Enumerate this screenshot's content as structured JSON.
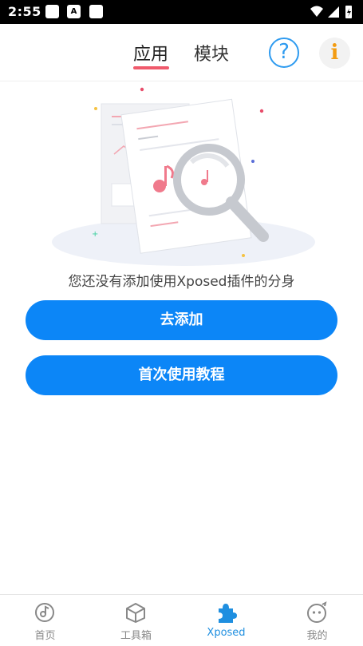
{
  "status_bar": {
    "time": "2:55"
  },
  "header": {
    "tabs": [
      {
        "label": "应用",
        "active": true
      },
      {
        "label": "模块",
        "active": false
      }
    ],
    "help_icon": "question-circle-icon",
    "info_icon": "info-icon",
    "help_glyph": "?",
    "info_glyph": "i"
  },
  "empty_state": {
    "illustration": "document-magnifier-illustration",
    "message": "您还没有添加使用Xposed插件的分身"
  },
  "actions": {
    "add_label": "去添加",
    "tutorial_label": "首次使用教程"
  },
  "bottom_nav": {
    "items": [
      {
        "label": "首页",
        "icon": "home-disc-icon",
        "active": false
      },
      {
        "label": "工具箱",
        "icon": "cube-icon",
        "active": false
      },
      {
        "label": "Xposed",
        "icon": "puzzle-icon",
        "active": true
      },
      {
        "label": "我的",
        "icon": "smiley-face-icon",
        "active": false
      }
    ]
  },
  "colors": {
    "accent": "#0c86f7",
    "tab_indicator": "#f05a6c",
    "help": "#2e9bf0",
    "info": "#f39c12",
    "nav_active": "#1f8fe0"
  }
}
